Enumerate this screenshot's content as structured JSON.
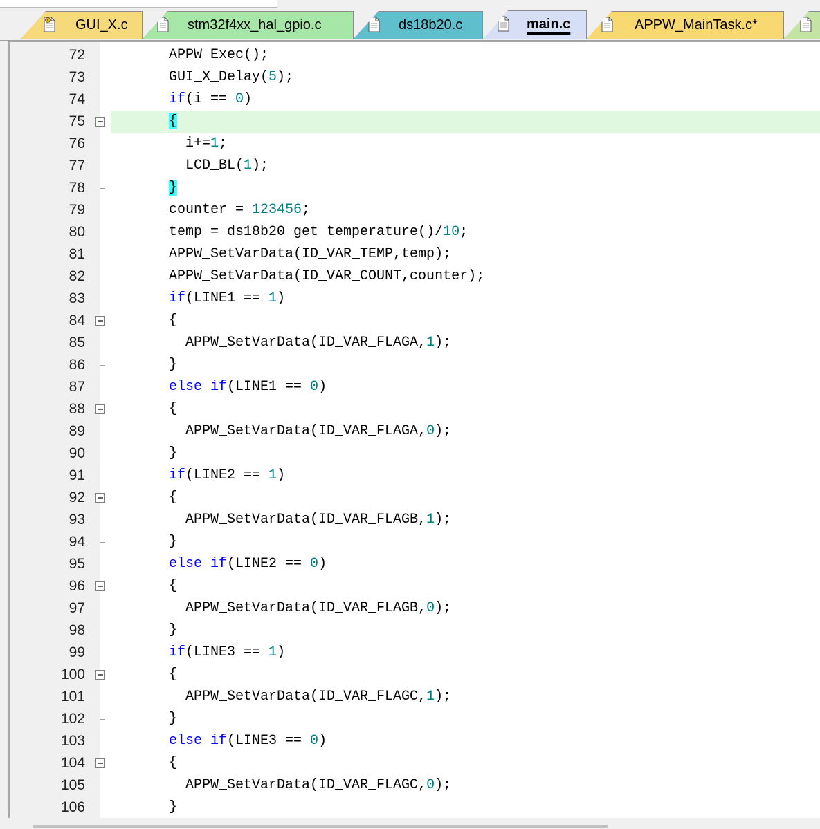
{
  "tabs": [
    {
      "label": "GUI_X.c",
      "color": "#f5d97a",
      "icon": "gear-file-icon",
      "active": false
    },
    {
      "label": "stm32f4xx_hal_gpio.c",
      "color": "#a6e6a6",
      "icon": "file-icon",
      "active": false
    },
    {
      "label": "ds18b20.c",
      "color": "#5fbfcc",
      "icon": "file-icon",
      "active": false
    },
    {
      "label": "main.c",
      "color": "#d6dff5",
      "icon": "file-icon",
      "active": true
    },
    {
      "label": "APPW_MainTask.c*",
      "color": "#f8d870",
      "icon": "file-icon",
      "active": false
    },
    {
      "label": "",
      "color": "#c4e4a4",
      "icon": "file-icon",
      "active": false
    }
  ],
  "editor": {
    "highlight_color": "#e0f8e0",
    "brace_match_color": "#40ffff",
    "lines": [
      {
        "n": "72",
        "fold": "",
        "tokens": [
          [
            "t",
            "APPW_Exec();"
          ]
        ]
      },
      {
        "n": "73",
        "fold": "",
        "tokens": [
          [
            "t",
            "GUI_X_Delay("
          ],
          [
            "n",
            "5"
          ],
          [
            "t",
            ");"
          ]
        ]
      },
      {
        "n": "74",
        "fold": "",
        "tokens": [
          [
            "k",
            "if"
          ],
          [
            "t",
            "(i == "
          ],
          [
            "n",
            "0"
          ],
          [
            "t",
            ")"
          ]
        ]
      },
      {
        "n": "75",
        "fold": "open",
        "hl": true,
        "tokens": [
          [
            "b",
            "{"
          ]
        ]
      },
      {
        "n": "76",
        "fold": "line",
        "tokens": [
          [
            "t",
            "  i+="
          ],
          [
            "n",
            "1"
          ],
          [
            "t",
            ";"
          ]
        ]
      },
      {
        "n": "77",
        "fold": "line",
        "tokens": [
          [
            "t",
            "  LCD_BL("
          ],
          [
            "n",
            "1"
          ],
          [
            "t",
            ");"
          ]
        ]
      },
      {
        "n": "78",
        "fold": "end",
        "tokens": [
          [
            "b",
            "}"
          ]
        ]
      },
      {
        "n": "79",
        "fold": "",
        "tokens": [
          [
            "t",
            "counter = "
          ],
          [
            "n",
            "123456"
          ],
          [
            "t",
            ";"
          ]
        ]
      },
      {
        "n": "80",
        "fold": "",
        "tokens": [
          [
            "t",
            "temp = ds18b20_get_temperature()/"
          ],
          [
            "n",
            "10"
          ],
          [
            "t",
            ";"
          ]
        ]
      },
      {
        "n": "81",
        "fold": "",
        "tokens": [
          [
            "t",
            "APPW_SetVarData(ID_VAR_TEMP,temp);"
          ]
        ]
      },
      {
        "n": "82",
        "fold": "",
        "tokens": [
          [
            "t",
            "APPW_SetVarData(ID_VAR_COUNT,counter);"
          ]
        ]
      },
      {
        "n": "83",
        "fold": "",
        "tokens": [
          [
            "k",
            "if"
          ],
          [
            "t",
            "(LINE1 == "
          ],
          [
            "n",
            "1"
          ],
          [
            "t",
            ")"
          ]
        ]
      },
      {
        "n": "84",
        "fold": "open",
        "tokens": [
          [
            "t",
            "{"
          ]
        ]
      },
      {
        "n": "85",
        "fold": "line",
        "tokens": [
          [
            "t",
            "  APPW_SetVarData(ID_VAR_FLAGA,"
          ],
          [
            "n",
            "1"
          ],
          [
            "t",
            ");"
          ]
        ]
      },
      {
        "n": "86",
        "fold": "end",
        "tokens": [
          [
            "t",
            "}"
          ]
        ]
      },
      {
        "n": "87",
        "fold": "",
        "tokens": [
          [
            "k",
            "else if"
          ],
          [
            "t",
            "(LINE1 == "
          ],
          [
            "n",
            "0"
          ],
          [
            "t",
            ")"
          ]
        ]
      },
      {
        "n": "88",
        "fold": "open",
        "tokens": [
          [
            "t",
            "{"
          ]
        ]
      },
      {
        "n": "89",
        "fold": "line",
        "tokens": [
          [
            "t",
            "  APPW_SetVarData(ID_VAR_FLAGA,"
          ],
          [
            "n",
            "0"
          ],
          [
            "t",
            ");"
          ]
        ]
      },
      {
        "n": "90",
        "fold": "end",
        "tokens": [
          [
            "t",
            "}"
          ]
        ]
      },
      {
        "n": "91",
        "fold": "",
        "tokens": [
          [
            "k",
            "if"
          ],
          [
            "t",
            "(LINE2 == "
          ],
          [
            "n",
            "1"
          ],
          [
            "t",
            ")"
          ]
        ]
      },
      {
        "n": "92",
        "fold": "open",
        "tokens": [
          [
            "t",
            "{"
          ]
        ]
      },
      {
        "n": "93",
        "fold": "line",
        "tokens": [
          [
            "t",
            "  APPW_SetVarData(ID_VAR_FLAGB,"
          ],
          [
            "n",
            "1"
          ],
          [
            "t",
            ");"
          ]
        ]
      },
      {
        "n": "94",
        "fold": "end",
        "tokens": [
          [
            "t",
            "}"
          ]
        ]
      },
      {
        "n": "95",
        "fold": "",
        "tokens": [
          [
            "k",
            "else if"
          ],
          [
            "t",
            "(LINE2 == "
          ],
          [
            "n",
            "0"
          ],
          [
            "t",
            ")"
          ]
        ]
      },
      {
        "n": "96",
        "fold": "open",
        "tokens": [
          [
            "t",
            "{"
          ]
        ]
      },
      {
        "n": "97",
        "fold": "line",
        "tokens": [
          [
            "t",
            "  APPW_SetVarData(ID_VAR_FLAGB,"
          ],
          [
            "n",
            "0"
          ],
          [
            "t",
            ");"
          ]
        ]
      },
      {
        "n": "98",
        "fold": "end",
        "tokens": [
          [
            "t",
            "}"
          ]
        ]
      },
      {
        "n": "99",
        "fold": "",
        "tokens": [
          [
            "k",
            "if"
          ],
          [
            "t",
            "(LINE3 == "
          ],
          [
            "n",
            "1"
          ],
          [
            "t",
            ")"
          ]
        ]
      },
      {
        "n": "100",
        "fold": "open",
        "tokens": [
          [
            "t",
            "{"
          ]
        ]
      },
      {
        "n": "101",
        "fold": "line",
        "tokens": [
          [
            "t",
            "  APPW_SetVarData(ID_VAR_FLAGC,"
          ],
          [
            "n",
            "1"
          ],
          [
            "t",
            ");"
          ]
        ]
      },
      {
        "n": "102",
        "fold": "end",
        "tokens": [
          [
            "t",
            "}"
          ]
        ]
      },
      {
        "n": "103",
        "fold": "",
        "tokens": [
          [
            "k",
            "else if"
          ],
          [
            "t",
            "(LINE3 == "
          ],
          [
            "n",
            "0"
          ],
          [
            "t",
            ")"
          ]
        ]
      },
      {
        "n": "104",
        "fold": "open",
        "tokens": [
          [
            "t",
            "{"
          ]
        ]
      },
      {
        "n": "105",
        "fold": "line",
        "tokens": [
          [
            "t",
            "  APPW_SetVarData(ID_VAR_FLAGC,"
          ],
          [
            "n",
            "0"
          ],
          [
            "t",
            ");"
          ]
        ]
      },
      {
        "n": "106",
        "fold": "end",
        "tokens": [
          [
            "t",
            "}"
          ]
        ]
      }
    ]
  }
}
